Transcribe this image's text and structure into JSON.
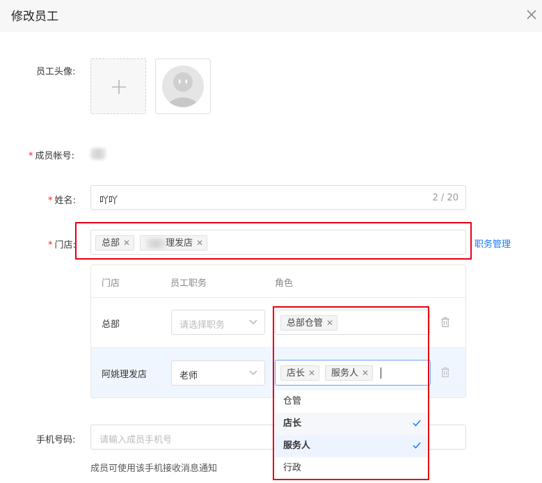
{
  "dialog": {
    "title": "修改员工"
  },
  "form": {
    "avatar_label": "员工头像:",
    "account_label": "成员帐号:",
    "name_label": "姓名:",
    "name_value": "吖吖",
    "name_counter": "2 / 20",
    "store_label": "门店:",
    "store_tags": [
      "总部",
      "理发店"
    ],
    "manage_link": "职务管理",
    "phone_label": "手机号码:",
    "phone_placeholder": "请输入成员手机号",
    "phone_hint": "成员可使用该手机接收消息通知"
  },
  "table": {
    "headers": [
      "门店",
      "员工职务",
      "角色"
    ],
    "rows": [
      {
        "store": "总部",
        "position": "",
        "position_placeholder": "请选择职务",
        "roles": [
          "总部仓管"
        ]
      },
      {
        "store": "阿姚理发店",
        "position": "老师",
        "position_placeholder": "",
        "roles": [
          "店长",
          "服务人"
        ]
      }
    ]
  },
  "dropdown": {
    "options": [
      {
        "label": "仓管",
        "selected": false
      },
      {
        "label": "店长",
        "selected": true
      },
      {
        "label": "服务人",
        "selected": true
      },
      {
        "label": "行政",
        "selected": false
      }
    ]
  },
  "colors": {
    "accent": "#1677ff",
    "required": "#f5222d",
    "annotation": "#e60012"
  }
}
